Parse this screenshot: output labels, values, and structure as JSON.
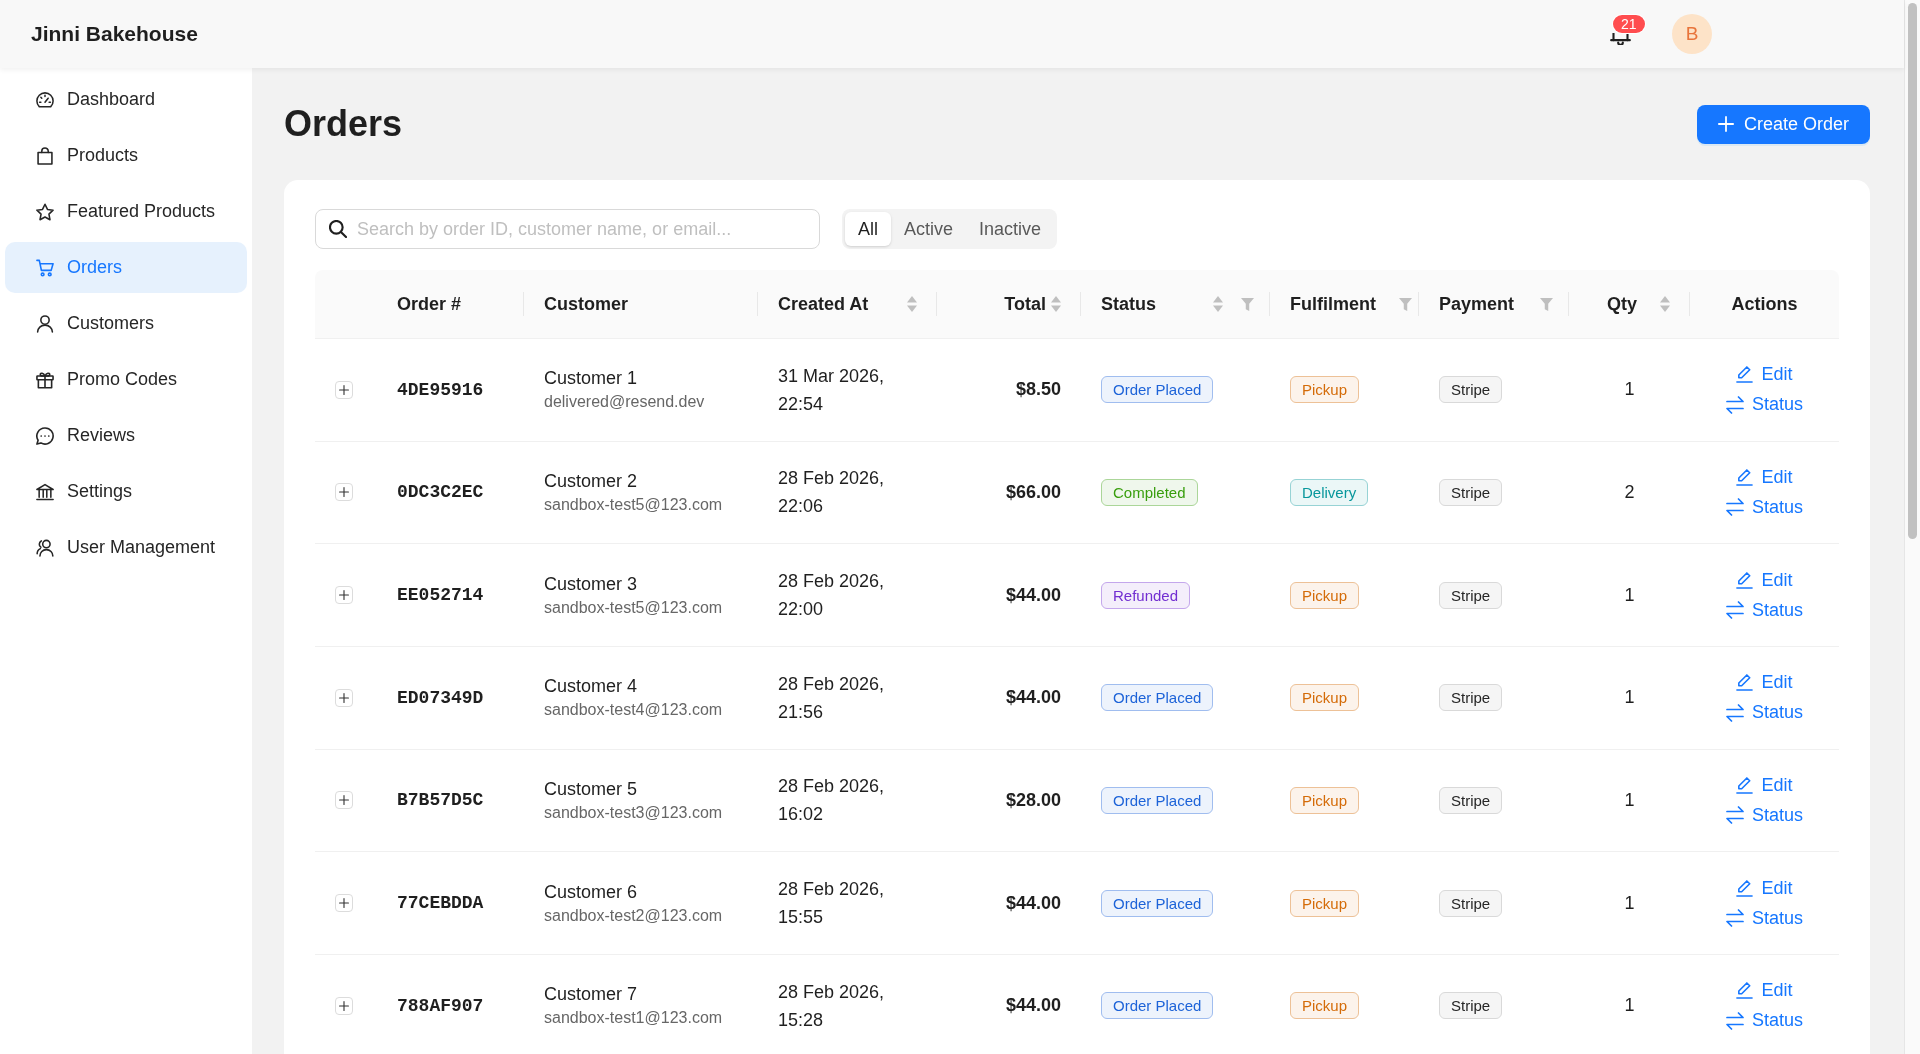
{
  "header": {
    "brand": "Jinni Bakehouse",
    "notification_badge": "21",
    "avatar_initial": "B"
  },
  "sidebar": {
    "items": [
      {
        "label": "Dashboard",
        "selected": false
      },
      {
        "label": "Products",
        "selected": false
      },
      {
        "label": "Featured Products",
        "selected": false
      },
      {
        "label": "Orders",
        "selected": true
      },
      {
        "label": "Customers",
        "selected": false
      },
      {
        "label": "Promo Codes",
        "selected": false
      },
      {
        "label": "Reviews",
        "selected": false
      },
      {
        "label": "Settings",
        "selected": false
      },
      {
        "label": "User Management",
        "selected": false
      }
    ]
  },
  "page": {
    "title": "Orders",
    "create_button": "Create Order"
  },
  "search": {
    "placeholder": "Search by order ID, customer name, or email..."
  },
  "filter_tabs": [
    {
      "label": "All",
      "selected": true
    },
    {
      "label": "Active",
      "selected": false
    },
    {
      "label": "Inactive",
      "selected": false
    }
  ],
  "table": {
    "columns": [
      {
        "label": "Order #",
        "sortable": false,
        "filterable": false
      },
      {
        "label": "Customer",
        "sortable": false,
        "filterable": false
      },
      {
        "label": "Created At",
        "sortable": true,
        "filterable": false
      },
      {
        "label": "Total",
        "sortable": true,
        "filterable": false
      },
      {
        "label": "Status",
        "sortable": true,
        "filterable": true
      },
      {
        "label": "Fulfilment",
        "sortable": false,
        "filterable": true
      },
      {
        "label": "Payment",
        "sortable": false,
        "filterable": true
      },
      {
        "label": "Qty",
        "sortable": true,
        "filterable": false
      },
      {
        "label": "Actions",
        "sortable": false,
        "filterable": false
      }
    ],
    "rows": [
      {
        "expanded": false,
        "order_id": "4DE95916",
        "customer": {
          "name": "Customer 1",
          "email": "delivered@resend.dev"
        },
        "created_at": "31 Mar 2026, 22:54",
        "total": "$8.50",
        "status": {
          "label": "Order Placed",
          "color": "#1d63d8"
        },
        "fulfilment": {
          "label": "Pickup",
          "color": "#d46b08"
        },
        "payment": "Stripe",
        "qty": "1",
        "actions": [
          {
            "kind": "edit",
            "label": "Edit"
          },
          {
            "kind": "status",
            "label": "Status"
          }
        ]
      },
      {
        "expanded": false,
        "order_id": "0DC3C2EC",
        "customer": {
          "name": "Customer 2",
          "email": "sandbox-test5@123.com"
        },
        "created_at": "28 Feb 2026, 22:06",
        "total": "$66.00",
        "status": {
          "label": "Completed",
          "color": "#389e0d"
        },
        "fulfilment": {
          "label": "Delivery",
          "color": "#08979c"
        },
        "payment": "Stripe",
        "qty": "2",
        "actions": [
          {
            "kind": "edit",
            "label": "Edit"
          },
          {
            "kind": "status",
            "label": "Status"
          }
        ]
      },
      {
        "expanded": false,
        "order_id": "EE052714",
        "customer": {
          "name": "Customer 3",
          "email": "sandbox-test5@123.com"
        },
        "created_at": "28 Feb 2026, 22:00",
        "total": "$44.00",
        "status": {
          "label": "Refunded",
          "color": "#722ed1"
        },
        "fulfilment": {
          "label": "Pickup",
          "color": "#d46b08"
        },
        "payment": "Stripe",
        "qty": "1",
        "actions": [
          {
            "kind": "edit",
            "label": "Edit"
          },
          {
            "kind": "status",
            "label": "Status"
          }
        ]
      },
      {
        "expanded": false,
        "order_id": "ED07349D",
        "customer": {
          "name": "Customer 4",
          "email": "sandbox-test4@123.com"
        },
        "created_at": "28 Feb 2026, 21:56",
        "total": "$44.00",
        "status": {
          "label": "Order Placed",
          "color": "#1d63d8"
        },
        "fulfilment": {
          "label": "Pickup",
          "color": "#d46b08"
        },
        "payment": "Stripe",
        "qty": "1",
        "actions": [
          {
            "kind": "edit",
            "label": "Edit"
          },
          {
            "kind": "status",
            "label": "Status"
          }
        ]
      },
      {
        "expanded": false,
        "order_id": "B7B57D5C",
        "customer": {
          "name": "Customer 5",
          "email": "sandbox-test3@123.com"
        },
        "created_at": "28 Feb 2026, 16:02",
        "total": "$28.00",
        "status": {
          "label": "Order Placed",
          "color": "#1d63d8"
        },
        "fulfilment": {
          "label": "Pickup",
          "color": "#d46b08"
        },
        "payment": "Stripe",
        "qty": "1",
        "actions": [
          {
            "kind": "edit",
            "label": "Edit"
          },
          {
            "kind": "status",
            "label": "Status"
          }
        ]
      },
      {
        "expanded": false,
        "order_id": "77CEBDDA",
        "customer": {
          "name": "Customer 6",
          "email": "sandbox-test2@123.com"
        },
        "created_at": "28 Feb 2026, 15:55",
        "total": "$44.00",
        "status": {
          "label": "Order Placed",
          "color": "#1d63d8"
        },
        "fulfilment": {
          "label": "Pickup",
          "color": "#d46b08"
        },
        "payment": "Stripe",
        "qty": "1",
        "actions": [
          {
            "kind": "edit",
            "label": "Edit"
          },
          {
            "kind": "status",
            "label": "Status"
          }
        ]
      },
      {
        "expanded": false,
        "order_id": "788AF907",
        "customer": {
          "name": "Customer 7",
          "email": "sandbox-test1@123.com"
        },
        "created_at": "28 Feb 2026, 15:28",
        "total": "$44.00",
        "status": {
          "label": "Order Placed",
          "color": "#1d63d8"
        },
        "fulfilment": {
          "label": "Pickup",
          "color": "#d46b08"
        },
        "payment": "Stripe",
        "qty": "1",
        "actions": [
          {
            "kind": "edit",
            "label": "Edit"
          },
          {
            "kind": "status",
            "label": "Status"
          }
        ]
      }
    ]
  }
}
